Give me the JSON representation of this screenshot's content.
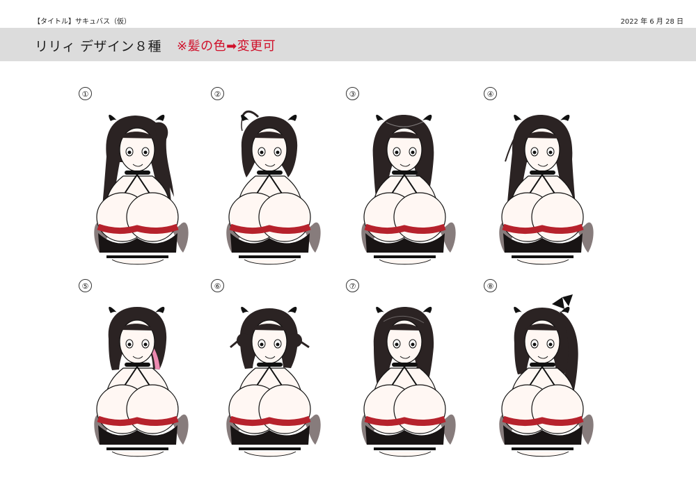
{
  "header": {
    "left_text": "【タイトル】サキュバス（仮）",
    "right_text": "2022 年 6 月 28 日"
  },
  "title_bar": {
    "title": "リリィ デザイン８種",
    "note": "※髪の色➡変更可",
    "background_color": "#dcdcdc",
    "note_color": "#d0102a"
  },
  "designs": [
    {
      "number": "①",
      "style": "long hair with side tail, one horn visible on left"
    },
    {
      "number": "②",
      "style": "short bob with ahoge"
    },
    {
      "number": "③",
      "style": "medium-long hair with crossed bangs"
    },
    {
      "number": "④",
      "style": "long straight hair"
    },
    {
      "number": "⑤",
      "style": "bob with blunt bangs and pink inner color"
    },
    {
      "number": "⑥",
      "style": "bob with twin small buns"
    },
    {
      "number": "⑦",
      "style": "medium hair with side part"
    },
    {
      "number": "⑧",
      "style": "side ponytail with bow"
    }
  ]
}
